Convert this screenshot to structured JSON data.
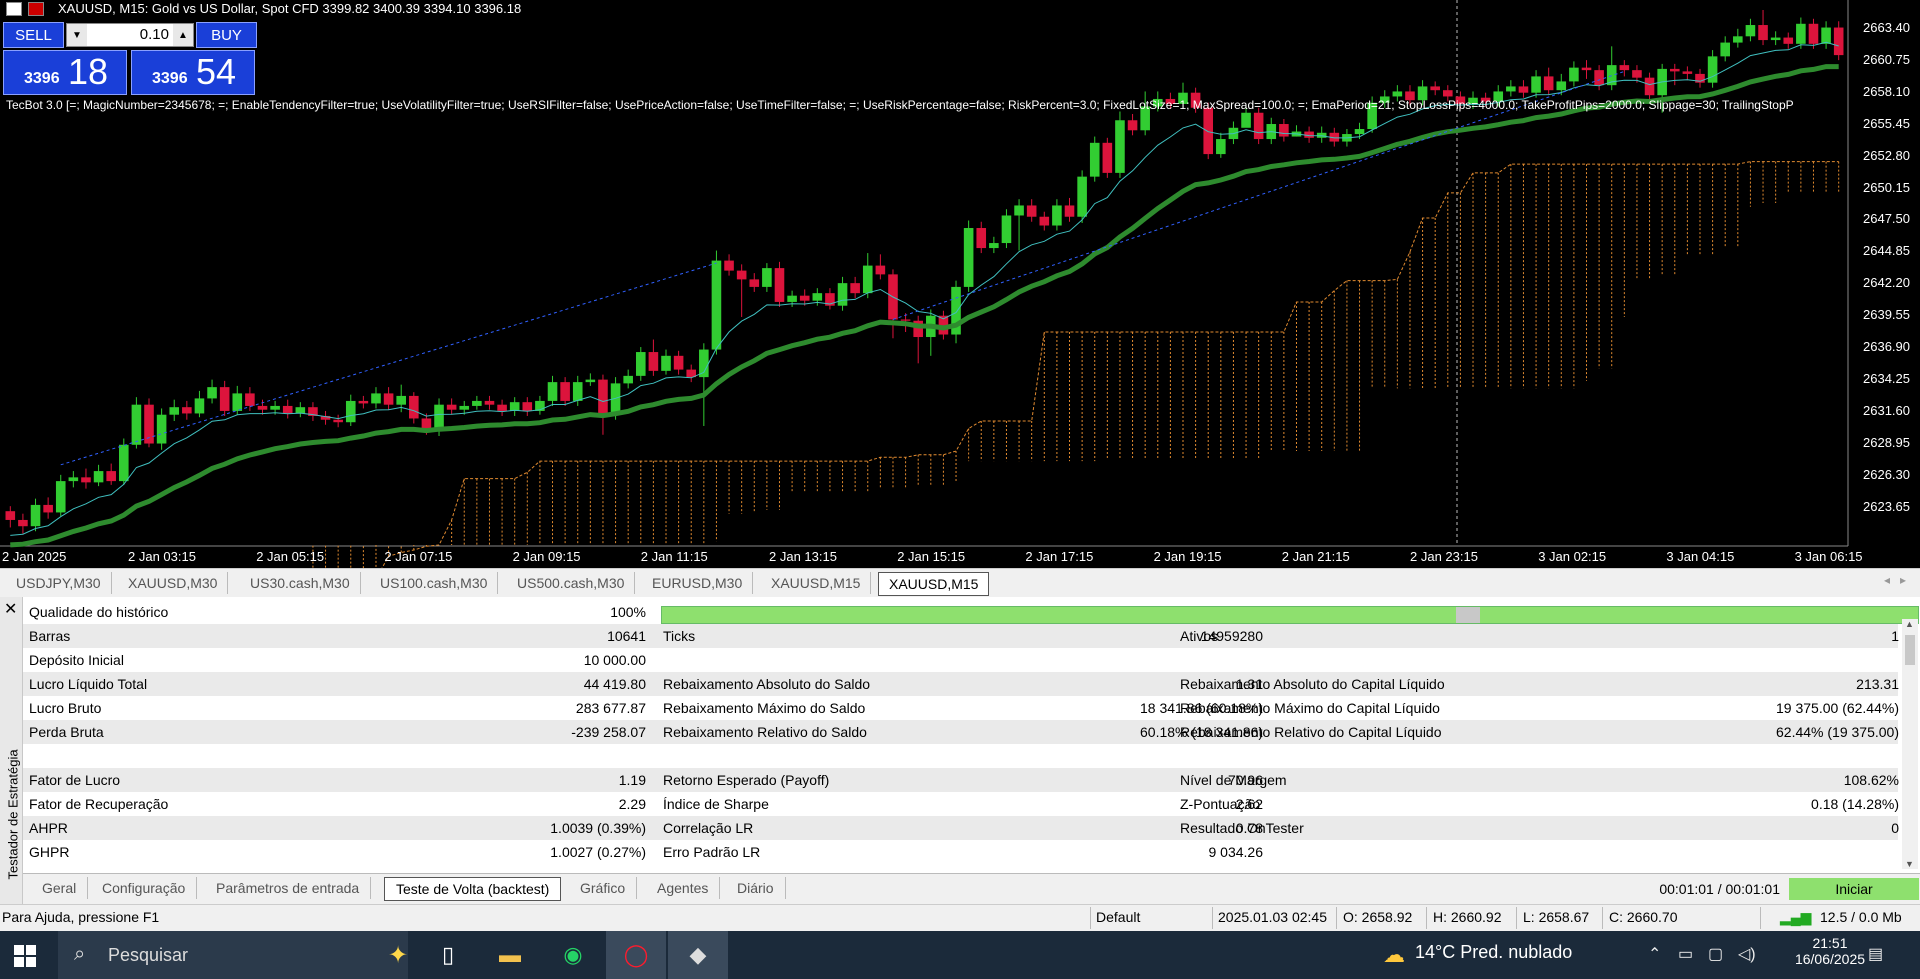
{
  "chart": {
    "title": "XAUUSD, M15:  Gold vs US Dollar, Spot CFD  3399.82 3400.39 3394.10 3396.18",
    "info_line": "TecBot 3.0 [=; MagicNumber=2345678; =; EnableTendencyFilter=true; UseVolatilityFilter=true; UseRSIFilter=false; UsePriceAction=false; UseTimeFilter=false; =; UseRiskPercentage=false; RiskPercent=3.0; FixedLotSize=1; MaxSpread=100.0; =; EmaPeriod=21; StopLossPips=4000.0; TakeProfitPips=2000.0; Slippage=30; TrailingStopP",
    "sell_label": "SELL",
    "buy_label": "BUY",
    "lot": "0.10",
    "sell_price_small": "3396",
    "sell_price_big": "18",
    "buy_price_small": "3396",
    "buy_price_big": "54",
    "y_ticks": [
      "2663.40",
      "2660.75",
      "2658.10",
      "2655.45",
      "2652.80",
      "2650.15",
      "2647.50",
      "2644.85",
      "2642.20",
      "2639.55",
      "2636.90",
      "2634.25",
      "2631.60",
      "2628.95",
      "2626.30",
      "2623.65"
    ],
    "x_ticks": [
      "2 Jan 2025",
      "2 Jan 03:15",
      "2 Jan 05:15",
      "2 Jan 07:15",
      "2 Jan 09:15",
      "2 Jan 11:15",
      "2 Jan 13:15",
      "2 Jan 15:15",
      "2 Jan 17:15",
      "2 Jan 19:15",
      "2 Jan 21:15",
      "2 Jan 23:15",
      "3 Jan 02:15",
      "3 Jan 04:15",
      "3 Jan 06:15"
    ],
    "colors": {
      "bull": "#32cd32",
      "bear": "#dc143c",
      "ema": "#2e8b2e",
      "ma_fast": "#40c0c0",
      "cloud": "#e08a30"
    }
  },
  "chart_data": {
    "type": "candlestick",
    "title": "XAUUSD, M15",
    "ylim": [
      2622.5,
      2664.8
    ],
    "candles": [
      [
        2624.8,
        2624.1,
        2625.2,
        2623.5
      ],
      [
        2624.1,
        2623.6,
        2624.6,
        2623.0
      ],
      [
        2623.6,
        2625.3,
        2625.8,
        2623.2
      ],
      [
        2625.3,
        2624.7,
        2625.9,
        2624.2
      ],
      [
        2624.7,
        2627.2,
        2627.7,
        2624.4
      ],
      [
        2627.2,
        2627.5,
        2628.0,
        2626.7
      ],
      [
        2627.5,
        2627.1,
        2628.2,
        2626.6
      ],
      [
        2627.1,
        2628.0,
        2628.5,
        2626.8
      ],
      [
        2628.0,
        2627.2,
        2628.6,
        2626.9
      ],
      [
        2627.2,
        2630.1,
        2630.6,
        2626.9
      ],
      [
        2630.1,
        2633.3,
        2633.9,
        2629.8
      ],
      [
        2633.3,
        2630.2,
        2633.8,
        2629.9
      ],
      [
        2630.2,
        2632.5,
        2633.0,
        2629.7
      ],
      [
        2632.5,
        2633.1,
        2633.7,
        2632.0
      ],
      [
        2633.1,
        2632.6,
        2633.6,
        2632.1
      ],
      [
        2632.6,
        2633.8,
        2634.4,
        2632.3
      ],
      [
        2633.8,
        2634.7,
        2635.3,
        2633.4
      ],
      [
        2634.7,
        2632.8,
        2635.2,
        2632.4
      ],
      [
        2632.8,
        2634.2,
        2634.8,
        2632.5
      ],
      [
        2634.2,
        2633.2,
        2634.7,
        2632.8
      ],
      [
        2633.2,
        2632.9,
        2633.7,
        2632.5
      ],
      [
        2632.9,
        2633.2,
        2633.6,
        2632.5
      ],
      [
        2633.2,
        2632.6,
        2633.7,
        2632.2
      ],
      [
        2632.6,
        2633.1,
        2633.5,
        2632.3
      ],
      [
        2633.1,
        2632.4,
        2633.5,
        2632.0
      ],
      [
        2632.4,
        2632.1,
        2632.8,
        2631.7
      ],
      [
        2632.1,
        2631.9,
        2632.5,
        2631.5
      ],
      [
        2631.9,
        2633.6,
        2634.1,
        2631.6
      ],
      [
        2633.6,
        2633.4,
        2634.0,
        2633.0
      ],
      [
        2633.4,
        2634.2,
        2634.7,
        2633.0
      ],
      [
        2634.2,
        2633.3,
        2634.7,
        2632.9
      ],
      [
        2633.3,
        2634.0,
        2634.9,
        2632.7
      ],
      [
        2634.0,
        2632.2,
        2634.3,
        2631.8
      ],
      [
        2632.2,
        2631.2,
        2632.6,
        2630.9
      ],
      [
        2631.2,
        2633.3,
        2633.8,
        2630.8
      ],
      [
        2633.3,
        2632.9,
        2633.8,
        2632.5
      ],
      [
        2632.9,
        2633.2,
        2633.6,
        2632.5
      ],
      [
        2633.2,
        2633.6,
        2634.0,
        2632.9
      ],
      [
        2633.6,
        2633.3,
        2634.0,
        2632.9
      ],
      [
        2633.3,
        2632.8,
        2633.7,
        2632.4
      ],
      [
        2632.8,
        2633.5,
        2633.9,
        2632.4
      ],
      [
        2633.5,
        2632.8,
        2633.9,
        2632.4
      ],
      [
        2632.8,
        2633.6,
        2634.0,
        2632.5
      ],
      [
        2633.6,
        2635.1,
        2635.6,
        2633.2
      ],
      [
        2635.1,
        2633.6,
        2635.5,
        2633.2
      ],
      [
        2633.6,
        2635.1,
        2635.6,
        2633.2
      ],
      [
        2635.1,
        2635.3,
        2635.8,
        2634.8
      ],
      [
        2635.3,
        2632.5,
        2635.7,
        2630.9
      ],
      [
        2632.5,
        2635.0,
        2635.5,
        2632.1
      ],
      [
        2635.0,
        2635.6,
        2636.1,
        2634.6
      ],
      [
        2635.6,
        2637.5,
        2637.9,
        2635.2
      ],
      [
        2637.5,
        2636.0,
        2638.5,
        2635.6
      ],
      [
        2636.0,
        2637.2,
        2637.7,
        2635.7
      ],
      [
        2637.2,
        2636.1,
        2637.6,
        2635.7
      ],
      [
        2636.1,
        2635.5,
        2636.5,
        2635.1
      ],
      [
        2635.5,
        2637.7,
        2638.2,
        2631.6
      ],
      [
        2637.7,
        2644.8,
        2645.6,
        2637.3
      ],
      [
        2644.8,
        2644.0,
        2645.3,
        2643.6
      ],
      [
        2644.0,
        2643.3,
        2644.5,
        2640.3
      ],
      [
        2643.3,
        2642.7,
        2643.8,
        2642.3
      ],
      [
        2642.7,
        2644.2,
        2644.6,
        2642.3
      ],
      [
        2644.2,
        2641.5,
        2644.7,
        2641.1
      ],
      [
        2641.5,
        2642.0,
        2642.4,
        2641.1
      ],
      [
        2642.0,
        2641.6,
        2642.5,
        2641.2
      ],
      [
        2641.6,
        2642.2,
        2642.6,
        2641.2
      ],
      [
        2642.2,
        2641.2,
        2642.6,
        2640.9
      ],
      [
        2641.2,
        2643.0,
        2643.5,
        2640.8
      ],
      [
        2643.0,
        2642.2,
        2643.5,
        2641.8
      ],
      [
        2642.2,
        2644.4,
        2645.4,
        2641.8
      ],
      [
        2644.4,
        2643.7,
        2645.3,
        2643.3
      ],
      [
        2643.7,
        2640.1,
        2644.1,
        2638.6
      ],
      [
        2640.1,
        2640.0,
        2640.6,
        2639.1
      ],
      [
        2640.0,
        2638.7,
        2640.4,
        2636.6
      ],
      [
        2638.7,
        2640.4,
        2640.9,
        2637.2
      ],
      [
        2640.4,
        2638.9,
        2640.8,
        2638.5
      ],
      [
        2638.9,
        2642.7,
        2643.2,
        2638.2
      ],
      [
        2642.7,
        2647.4,
        2648.0,
        2642.3
      ],
      [
        2647.4,
        2645.8,
        2647.9,
        2645.4
      ],
      [
        2645.8,
        2646.2,
        2646.7,
        2645.4
      ],
      [
        2646.2,
        2648.4,
        2648.9,
        2645.8
      ],
      [
        2648.4,
        2649.2,
        2649.7,
        2645.6
      ],
      [
        2649.2,
        2648.3,
        2649.7,
        2647.9
      ],
      [
        2648.3,
        2647.6,
        2648.7,
        2647.2
      ],
      [
        2647.6,
        2649.2,
        2649.7,
        2647.2
      ],
      [
        2649.2,
        2648.3,
        2649.8,
        2647.9
      ],
      [
        2648.3,
        2651.5,
        2652.0,
        2647.8
      ],
      [
        2651.5,
        2654.2,
        2654.7,
        2651.1
      ],
      [
        2654.2,
        2651.8,
        2654.6,
        2651.4
      ],
      [
        2651.8,
        2656.0,
        2656.7,
        2651.4
      ],
      [
        2656.0,
        2655.2,
        2656.5,
        2654.8
      ],
      [
        2655.2,
        2657.1,
        2658.3,
        2654.8
      ],
      [
        2657.1,
        2657.7,
        2658.3,
        2656.7
      ],
      [
        2657.7,
        2657.3,
        2658.2,
        2656.9
      ],
      [
        2657.3,
        2658.2,
        2659.0,
        2656.9
      ],
      [
        2658.2,
        2657.0,
        2658.6,
        2656.6
      ],
      [
        2657.0,
        2653.3,
        2657.4,
        2652.9
      ],
      [
        2653.3,
        2654.5,
        2655.0,
        2653.0
      ],
      [
        2654.5,
        2655.4,
        2655.9,
        2654.1
      ],
      [
        2655.4,
        2656.6,
        2657.1,
        2656.0
      ],
      [
        2656.6,
        2654.5,
        2657.0,
        2654.1
      ],
      [
        2654.5,
        2655.7,
        2656.2,
        2654.1
      ],
      [
        2655.7,
        2654.7,
        2656.1,
        2654.3
      ],
      [
        2654.7,
        2655.1,
        2655.6,
        2654.7
      ],
      [
        2655.1,
        2654.6,
        2655.5,
        2654.2
      ],
      [
        2654.6,
        2655.0,
        2655.5,
        2654.2
      ],
      [
        2655.0,
        2654.3,
        2655.4,
        2653.9
      ],
      [
        2654.3,
        2654.9,
        2655.3,
        2653.9
      ],
      [
        2654.9,
        2655.3,
        2655.8,
        2654.5
      ],
      [
        2655.3,
        2657.4,
        2657.9,
        2655.0
      ],
      [
        2657.4,
        2657.9,
        2658.4,
        2657.0
      ],
      [
        2657.9,
        2658.3,
        2658.8,
        2657.5
      ],
      [
        2658.3,
        2657.6,
        2658.8,
        2657.2
      ],
      [
        2657.6,
        2658.7,
        2659.2,
        2657.2
      ],
      [
        2658.7,
        2658.4,
        2659.1,
        2658.0
      ],
      [
        2658.4,
        2657.9,
        2658.8,
        2657.5
      ],
      [
        2657.9,
        2657.3,
        2658.3,
        2656.9
      ],
      [
        2657.3,
        2657.8,
        2658.3,
        2656.9
      ],
      [
        2657.8,
        2657.5,
        2658.2,
        2657.1
      ],
      [
        2657.5,
        2658.3,
        2658.8,
        2657.1
      ],
      [
        2658.3,
        2658.7,
        2659.2,
        2657.9
      ],
      [
        2658.7,
        2658.2,
        2659.2,
        2657.8
      ],
      [
        2658.2,
        2659.5,
        2660.0,
        2657.8
      ],
      [
        2659.5,
        2658.4,
        2660.2,
        2658.0
      ],
      [
        2658.4,
        2659.1,
        2659.7,
        2658.0
      ],
      [
        2659.1,
        2660.2,
        2660.7,
        2658.7
      ],
      [
        2660.2,
        2660.0,
        2660.8,
        2659.3
      ],
      [
        2660.0,
        2658.8,
        2660.4,
        2658.4
      ],
      [
        2658.8,
        2660.4,
        2661.9,
        2658.4
      ],
      [
        2660.4,
        2660.0,
        2660.8,
        2659.5
      ],
      [
        2660.0,
        2659.4,
        2660.4,
        2659.0
      ],
      [
        2659.4,
        2658.0,
        2659.8,
        2657.6
      ],
      [
        2658.0,
        2660.1,
        2660.5,
        2656.6
      ],
      [
        2660.1,
        2659.9,
        2660.5,
        2658.8
      ],
      [
        2659.9,
        2659.7,
        2660.3,
        2659.2
      ],
      [
        2659.7,
        2659.0,
        2660.1,
        2658.6
      ],
      [
        2659.0,
        2661.1,
        2661.6,
        2658.6
      ],
      [
        2661.1,
        2662.2,
        2662.7,
        2660.7
      ],
      [
        2662.2,
        2662.7,
        2663.3,
        2661.8
      ],
      [
        2662.7,
        2663.6,
        2664.1,
        2662.3
      ],
      [
        2663.6,
        2662.4,
        2664.8,
        2662.0
      ],
      [
        2662.4,
        2662.6,
        2663.1,
        2662.0
      ],
      [
        2662.6,
        2662.1,
        2663.0,
        2661.7
      ],
      [
        2662.1,
        2663.7,
        2664.2,
        2661.7
      ],
      [
        2663.7,
        2662.1,
        2664.1,
        2661.7
      ],
      [
        2662.1,
        2663.4,
        2663.9,
        2661.7
      ],
      [
        2663.4,
        2661.2,
        2663.9,
        2660.8
      ]
    ]
  },
  "symbol_tabs": [
    "USDJPY,M30",
    "XAUUSD,M30",
    "US30.cash,M30",
    "US100.cash,M30",
    "US500.cash,M30",
    "EURUSD,M30",
    "XAUUSD,M15",
    "XAUUSD,M15"
  ],
  "tester": {
    "side_label": "Testador de Estratégia",
    "quality_label": "Qualidade do histórico",
    "quality_value": "100%",
    "quality_fraction": 1.0,
    "rows": [
      {
        "l1": "Barras",
        "v1": "10641",
        "l2": "Ticks",
        "v2": "14959280",
        "l3": "Ativos",
        "v3": "1"
      },
      {
        "l1": "Depósito Inicial",
        "v1": "10 000.00",
        "l2": "",
        "v2": "",
        "l3": "",
        "v3": ""
      },
      {
        "l1": "Lucro Líquido Total",
        "v1": "44 419.80",
        "l2": "Rebaixamento Absoluto do Saldo",
        "v2": "1.31",
        "l3": "Rebaixamento Absoluto do Capital Líquido",
        "v3": "213.31"
      },
      {
        "l1": "Lucro Bruto",
        "v1": "283 677.87",
        "l2": "Rebaixamento Máximo do Saldo",
        "v2": "18 341.86 (60.18%)",
        "l3": "Rebaixamento Máximo do Capital Líquido",
        "v3": "19 375.00 (62.44%)"
      },
      {
        "l1": "Perda Bruta",
        "v1": "-239 258.07",
        "l2": "Rebaixamento Relativo do Saldo",
        "v2": "60.18% (18 341.86)",
        "l3": "Rebaixamento Relativo do Capital Líquido",
        "v3": "62.44% (19 375.00)"
      },
      {
        "l1": "",
        "v1": "",
        "l2": "",
        "v2": "",
        "l3": "",
        "v3": ""
      },
      {
        "l1": "Fator de Lucro",
        "v1": "1.19",
        "l2": "Retorno Esperado (Payoff)",
        "v2": "70.96",
        "l3": "Nível de Margem",
        "v3": "108.62%"
      },
      {
        "l1": "Fator de Recuperação",
        "v1": "2.29",
        "l2": "Índice de Sharpe",
        "v2": "2.62",
        "l3": "Z-Pontuação",
        "v3": "0.18 (14.28%)"
      },
      {
        "l1": "AHPR",
        "v1": "1.0039 (0.39%)",
        "l2": "Correlação LR",
        "v2": "0.78",
        "l3": "Resultado OnTester",
        "v3": "0"
      },
      {
        "l1": "GHPR",
        "v1": "1.0027 (0.27%)",
        "l2": "Erro Padrão LR",
        "v2": "9 034.26",
        "l3": "",
        "v3": ""
      }
    ],
    "tabs": [
      "Geral",
      "Configuração",
      "Parâmetros de entrada",
      "Teste de Volta (backtest)",
      "Gráfico",
      "Agentes",
      "Diário"
    ],
    "timer": "00:01:01 / 00:01:01",
    "start_label": "Iniciar"
  },
  "status": {
    "help": "Para Ajuda, pressione F1",
    "profile": "Default",
    "datetime": "2025.01.03 02:45",
    "open": "O: 2658.92",
    "high": "H: 2660.92",
    "low": "L: 2658.67",
    "close": "C: 2660.70",
    "traffic": "12.5 / 0.0 Mb"
  },
  "taskbar": {
    "search_placeholder": "Pesquisar",
    "weather": "14°C  Pred. nublado",
    "time": "21:51",
    "date": "16/06/2025"
  }
}
